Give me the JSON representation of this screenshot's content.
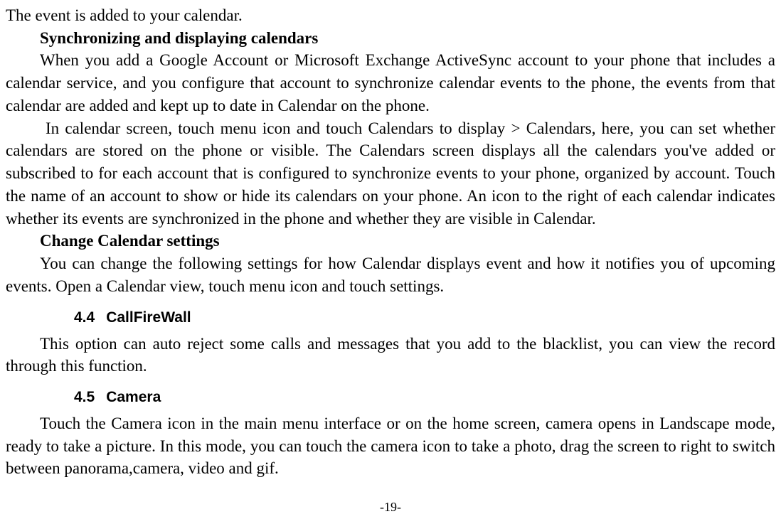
{
  "lines": {
    "l1": "The event is added to your calendar.",
    "h1": "Synchronizing and displaying calendars",
    "p1": "When you add a Google Account or Microsoft Exchange ActiveSync account to your phone that includes a calendar service, and you configure that account to synchronize calendar events to the phone, the events from that calendar are added and kept up to date in Calendar on the phone.",
    "p2": "In calendar screen, touch menu icon and touch Calendars to display > Calendars, here, you can set whether calendars are stored on the phone or visible. The Calendars screen displays all the calendars you've added or subscribed to for each account that is configured to synchronize events to your phone, organized by account. Touch the name of an account to show or hide its calendars on your phone. An icon to the right of each calendar indicates whether its events are synchronized in the phone and whether they are visible in Calendar.",
    "h2": "Change Calendar settings",
    "p3": "You can change the following settings for how Calendar displays event and how it notifies you of upcoming events. Open a Calendar view, touch menu icon and touch settings.",
    "s44num": "4.4",
    "s44title": "CallFireWall",
    "p4": "This option can auto reject some calls and messages that you add to the blacklist, you can view the record through this function.",
    "s45num": "4.5",
    "s45title": "Camera",
    "p5": "Touch the Camera icon in the main menu interface or on the home screen, camera opens in Landscape mode, ready to take a picture. In this mode, you can touch the camera icon to take a photo, drag the screen to right to switch between panorama,camera, video and gif.",
    "pagenum": "-19-"
  }
}
